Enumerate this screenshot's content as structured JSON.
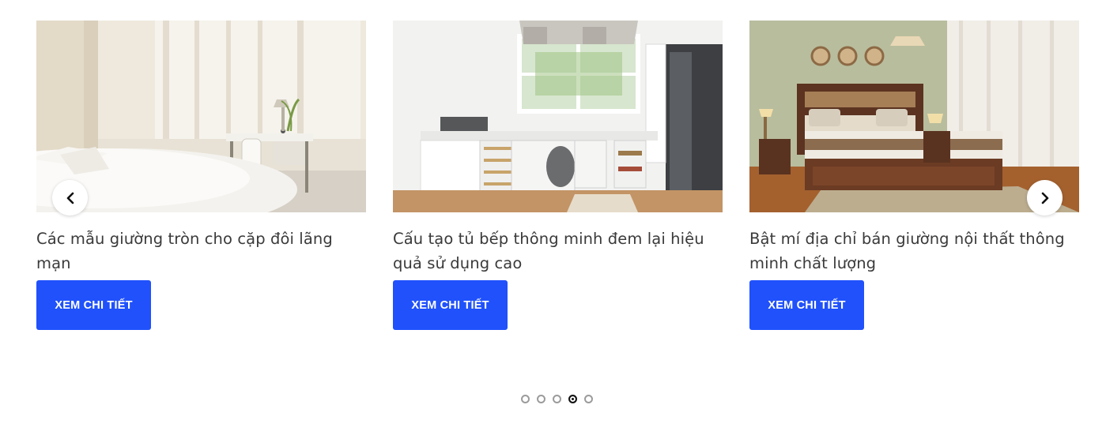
{
  "posts": [
    {
      "title": "Các mẫu giường tròn cho cặp đôi lãng mạn",
      "button_label": "XEM CHI TIẾT",
      "image_icon": "bedroom-round-bed-image"
    },
    {
      "title": "Cấu tạo tủ bếp thông minh đem lại hiệu quả sử dụng cao",
      "button_label": "XEM CHI TIẾT",
      "image_icon": "kitchen-cabinet-image"
    },
    {
      "title": "Bật mí địa chỉ bán giường nội thất thông minh chất lượng",
      "button_label": "XEM CHI TIẾT",
      "image_icon": "bedroom-wooden-bed-image"
    }
  ],
  "navigation": {
    "prev_icon": "chevron-left-icon",
    "next_icon": "chevron-right-icon"
  },
  "pagination": {
    "total": 5,
    "active_index": 4
  },
  "colors": {
    "button_bg": "#2051fb",
    "button_text": "#ffffff",
    "title_text": "#3a3a3a",
    "dot_inactive": "#9b9b9b",
    "dot_active": "#111111"
  }
}
